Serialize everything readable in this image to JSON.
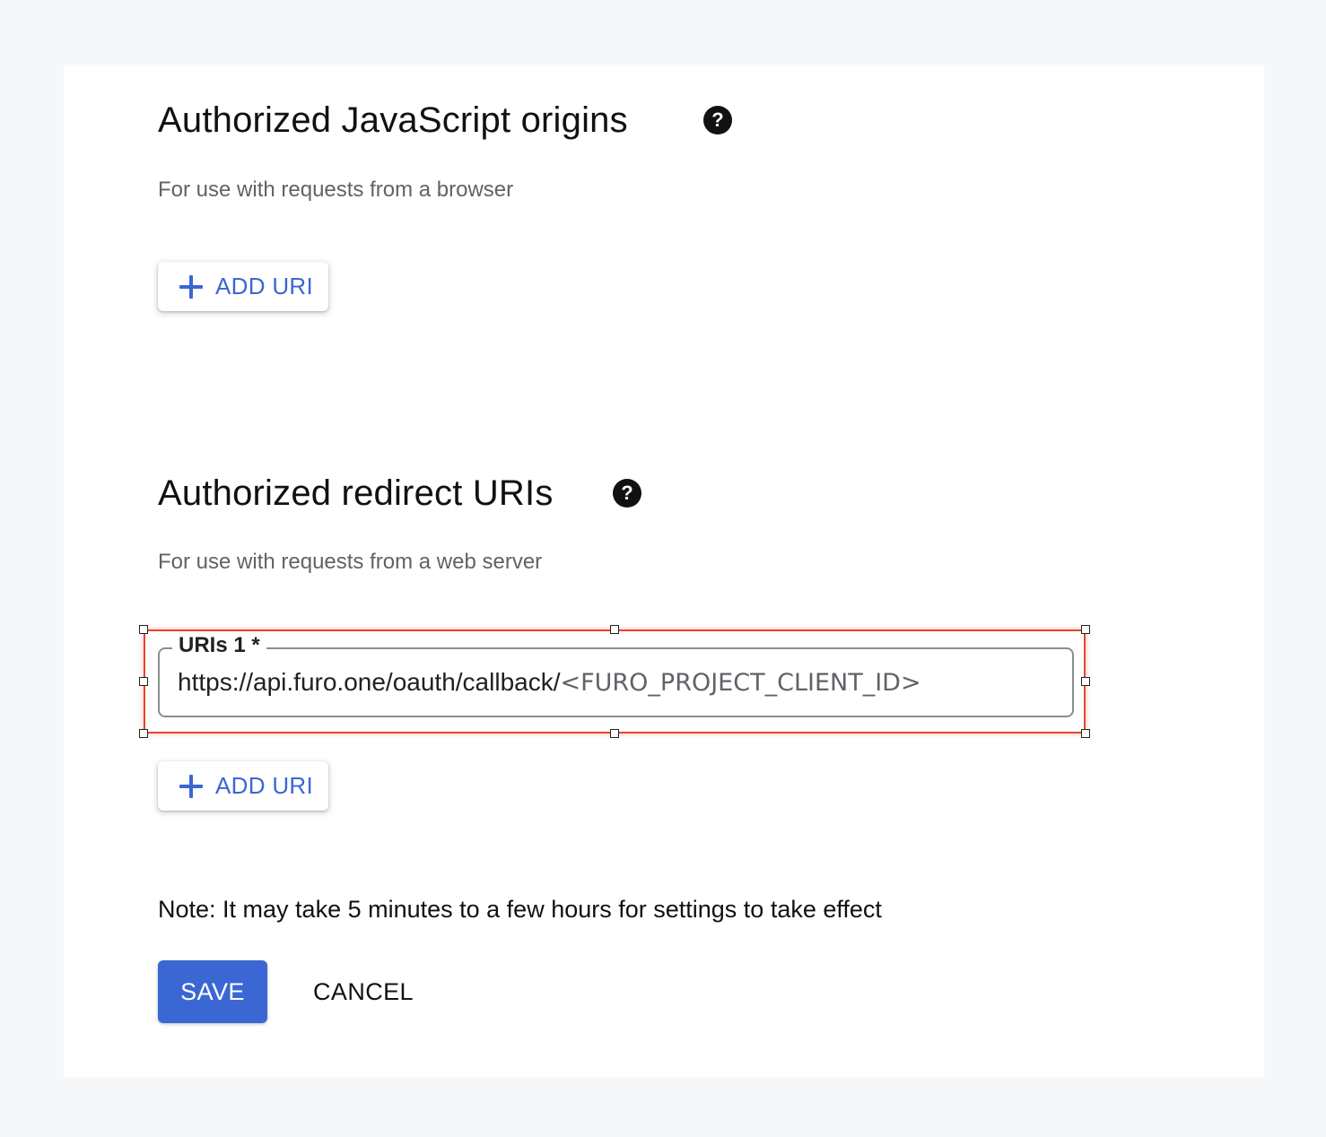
{
  "js_origins": {
    "title": "Authorized JavaScript origins",
    "help_icon": "?",
    "subtitle": "For use with requests from a browser",
    "add_uri_label": "ADD URI"
  },
  "redirect_uris": {
    "title": "Authorized redirect URIs",
    "help_icon": "?",
    "subtitle": "For use with requests from a web server",
    "field_label": "URIs 1 *",
    "field_value_prefix": "https://api.furo.one/oauth/callback/",
    "field_value_placeholder": "<FURO_PROJECT_CLIENT_ID>",
    "add_uri_label": "ADD URI"
  },
  "note": "Note: It may take 5 minutes to a few hours for settings to take effect",
  "actions": {
    "save_label": "SAVE",
    "cancel_label": "CANCEL"
  },
  "colors": {
    "accent": "#3b67d4",
    "selection_outline": "#e8452c",
    "background": "#f6f7f9"
  },
  "icons": {
    "help": "help-circle-icon",
    "add": "plus-icon"
  }
}
